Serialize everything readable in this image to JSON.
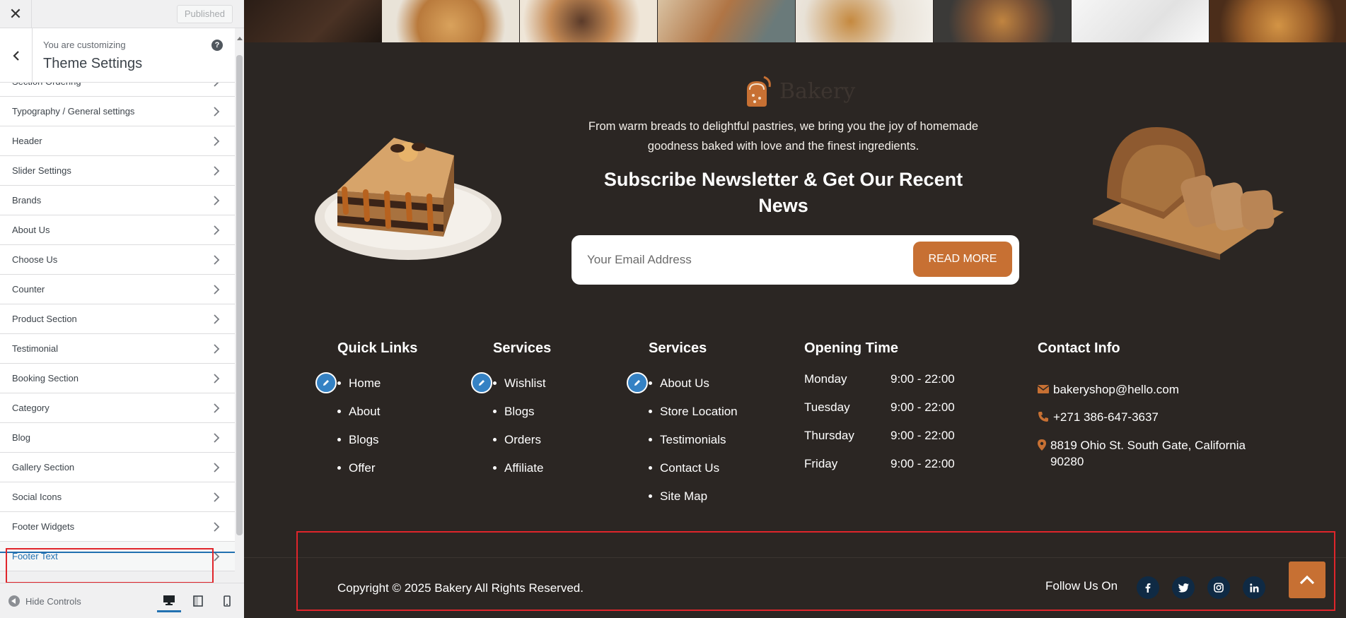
{
  "sidebar": {
    "published_label": "Published",
    "customizing_label": "You are customizing",
    "title": "Theme Settings",
    "help_glyph": "?",
    "items": [
      {
        "label": "Section Ordering"
      },
      {
        "label": "Typography / General settings"
      },
      {
        "label": "Header"
      },
      {
        "label": "Slider Settings"
      },
      {
        "label": "Brands"
      },
      {
        "label": "About Us"
      },
      {
        "label": "Choose Us"
      },
      {
        "label": "Counter"
      },
      {
        "label": "Product Section"
      },
      {
        "label": "Testimonial"
      },
      {
        "label": "Booking Section"
      },
      {
        "label": "Category"
      },
      {
        "label": "Blog"
      },
      {
        "label": "Gallery Section"
      },
      {
        "label": "Social Icons"
      },
      {
        "label": "Footer Widgets"
      },
      {
        "label": "Footer Text",
        "active": true
      }
    ],
    "hide_controls_label": "Hide Controls"
  },
  "preview": {
    "logo_text": "Bakery",
    "tagline": "From warm breads to delightful pastries, we bring you the joy of homemade goodness baked with love and the finest ingredients.",
    "newsletter_title": "Subscribe Newsletter & Get Our Recent News",
    "email_placeholder": "Your Email Address",
    "button_label": "READ MORE",
    "quick_links": {
      "title": "Quick Links",
      "items": [
        "Home",
        "About",
        "Blogs",
        "Offer"
      ]
    },
    "services_1": {
      "title": "Services",
      "items": [
        "Wishlist",
        "Blogs",
        "Orders",
        "Affiliate"
      ]
    },
    "services_2": {
      "title": "Services",
      "items": [
        "About Us",
        "Store Location",
        "Testimonials",
        "Contact Us",
        "Site Map"
      ]
    },
    "opening_time": {
      "title": "Opening Time",
      "rows": [
        {
          "day": "Monday",
          "hours": "9:00 - 22:00"
        },
        {
          "day": "Tuesday",
          "hours": "9:00 - 22:00"
        },
        {
          "day": "Thursday",
          "hours": "9:00 - 22:00"
        },
        {
          "day": "Friday",
          "hours": "9:00 - 22:00"
        }
      ]
    },
    "contact_info": {
      "title": "Contact Info",
      "email": "bakeryshop@hello.com",
      "phone": "+271 386-647-3637",
      "address_line1": "8819 Ohio St. South Gate, California",
      "address_line2": "90280"
    },
    "copyright": "Copyright © 2025 Bakery All Rights Reserved.",
    "follow_label": "Follow Us On",
    "social_icons": [
      "facebook-icon",
      "twitter-icon",
      "instagram-icon",
      "linkedin-icon"
    ]
  },
  "colors": {
    "accent": "#c77033",
    "background": "#2b2623",
    "highlight": "#e0252b",
    "wp_blue": "#2271b1"
  }
}
